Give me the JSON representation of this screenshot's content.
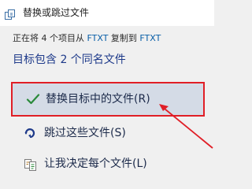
{
  "window": {
    "title": "替换或跳过文件",
    "icon": "file-replace-icon"
  },
  "progress": {
    "prefix": "正在将 4 个项目从 ",
    "source": "FTXT",
    "middle": " 复制到 ",
    "destination": "FTXT"
  },
  "headline": "目标包含 2 个同名文件",
  "options": {
    "replace": {
      "label": "替换目标中的文件(R)",
      "icon": "checkmark-icon",
      "icon_color": "#2a8a3a"
    },
    "skip": {
      "label": "跳过这些文件(S)",
      "icon": "skip-arrow-icon",
      "icon_color": "#1e3a8a"
    },
    "decide": {
      "label": "让我决定每个文件(L)",
      "icon": "compare-files-icon"
    }
  },
  "annotation": {
    "highlight_color": "#e01e26"
  }
}
